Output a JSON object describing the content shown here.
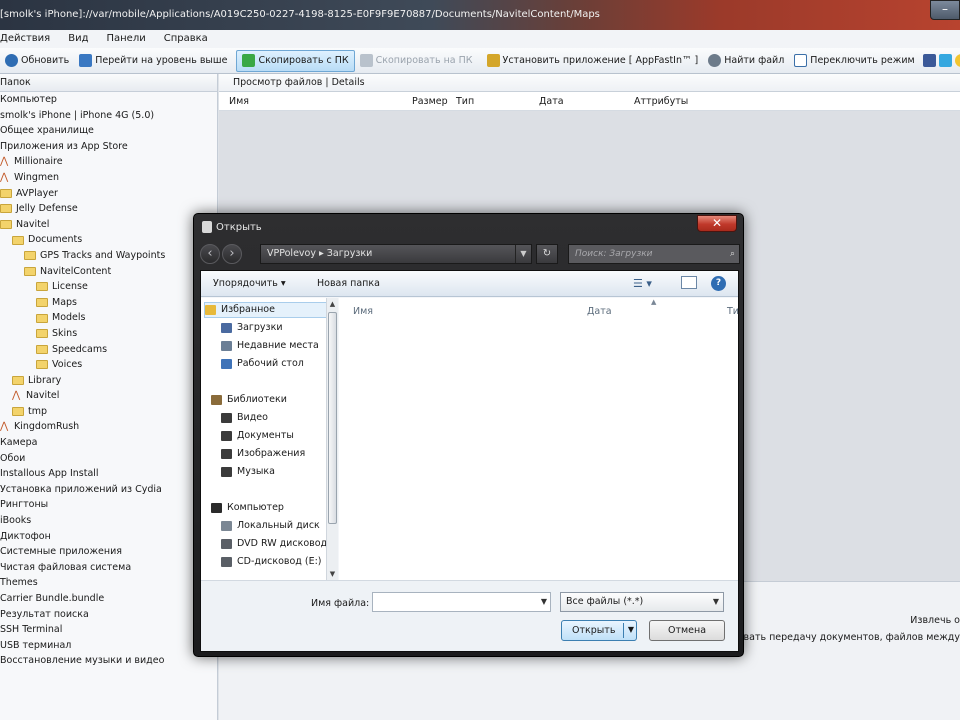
{
  "window": {
    "title": "[smolk's iPhone]://var/mobile/Applications/A019C250-0227-4198-8125-E0F9F9E70887/Documents/NavitelContent/Maps"
  },
  "menu": [
    "Действия",
    "Вид",
    "Панели",
    "Справка"
  ],
  "toolbar": {
    "refresh": "Обновить",
    "up": "Перейти на уровень выше",
    "copy_to_pc": "Скопировать с ПК",
    "copy_from_pc": "Скопировать на ПК",
    "install_app": "Установить приложение [ AppFastIn™ ]",
    "find_file": "Найти файл",
    "switch_mode": "Переключить режим"
  },
  "left_panel": {
    "header": "Папок",
    "tree": [
      {
        "label": "Компьютер",
        "indent": 0,
        "icon": "none"
      },
      {
        "label": "smolk's iPhone | iPhone 4G (5.0)",
        "indent": 0,
        "icon": "none"
      },
      {
        "label": "Общее хранилище",
        "indent": 0,
        "icon": "none"
      },
      {
        "label": "Приложения из App Store",
        "indent": 0,
        "icon": "none"
      },
      {
        "label": "Millionaire",
        "indent": 0,
        "icon": "app"
      },
      {
        "label": "Wingmen",
        "indent": 0,
        "icon": "app"
      },
      {
        "label": "AVPlayer",
        "indent": 0,
        "icon": "folder"
      },
      {
        "label": "Jelly Defense",
        "indent": 0,
        "icon": "folder"
      },
      {
        "label": "Navitel",
        "indent": 0,
        "icon": "folder"
      },
      {
        "label": "Documents",
        "indent": 1,
        "icon": "folder"
      },
      {
        "label": "GPS Tracks and Waypoints",
        "indent": 2,
        "icon": "folder"
      },
      {
        "label": "NavitelContent",
        "indent": 2,
        "icon": "folder"
      },
      {
        "label": "License",
        "indent": 3,
        "icon": "folder"
      },
      {
        "label": "Maps",
        "indent": 3,
        "icon": "folder"
      },
      {
        "label": "Models",
        "indent": 3,
        "icon": "folder"
      },
      {
        "label": "Skins",
        "indent": 3,
        "icon": "folder"
      },
      {
        "label": "Speedcams",
        "indent": 3,
        "icon": "folder"
      },
      {
        "label": "Voices",
        "indent": 3,
        "icon": "folder"
      },
      {
        "label": "Library",
        "indent": 1,
        "icon": "folder"
      },
      {
        "label": "Navitel",
        "indent": 1,
        "icon": "app"
      },
      {
        "label": "tmp",
        "indent": 1,
        "icon": "folder"
      },
      {
        "label": "KingdomRush",
        "indent": 0,
        "icon": "app"
      },
      {
        "label": "Камера",
        "indent": 0,
        "icon": "none"
      },
      {
        "label": "Обои",
        "indent": 0,
        "icon": "none"
      },
      {
        "label": "Installous App Install",
        "indent": 0,
        "icon": "none"
      },
      {
        "label": "Установка приложений из Cydia",
        "indent": 0,
        "icon": "none"
      },
      {
        "label": "Рингтоны",
        "indent": 0,
        "icon": "none"
      },
      {
        "label": "iBooks",
        "indent": 0,
        "icon": "none"
      },
      {
        "label": "Диктофон",
        "indent": 0,
        "icon": "none"
      },
      {
        "label": "Системные приложения",
        "indent": 0,
        "icon": "none"
      },
      {
        "label": "Чистая файловая система",
        "indent": 0,
        "icon": "none"
      },
      {
        "label": "Themes",
        "indent": 0,
        "icon": "none"
      },
      {
        "label": "Carrier Bundle.bundle",
        "indent": 0,
        "icon": "none"
      },
      {
        "label": "Результат поиска",
        "indent": 0,
        "icon": "none"
      },
      {
        "label": "SSH Terminal",
        "indent": 0,
        "icon": "none"
      },
      {
        "label": "USB терминал",
        "indent": 0,
        "icon": "none"
      },
      {
        "label": "Восстановление музыки и видео",
        "indent": 0,
        "icon": "none"
      }
    ]
  },
  "right_panel": {
    "breadcrumb": "Просмотр файлов  |  Details",
    "columns": {
      "name": "Имя",
      "size": "Размер",
      "type": "Тип",
      "date": "Дата",
      "attrs": "Аттрибуты"
    },
    "bottom_text_1": "Извлечь о",
    "bottom_text_2": "льзовать передачу документов, файлов между"
  },
  "dialog": {
    "title": "Открыть",
    "address": "VPPolevoy  ▸  Загрузки",
    "search_placeholder": "Поиск: Загрузки",
    "organize": "Упорядочить ▾",
    "new_folder": "Новая папка",
    "nav": {
      "favorites": "Избранное",
      "downloads": "Загрузки",
      "recent": "Недавние места",
      "desktop": "Рабочий стол",
      "libraries": "Библиотеки",
      "video": "Видео",
      "documents": "Документы",
      "images": "Изображения",
      "music": "Музыка",
      "computer": "Компьютер",
      "local_disk": "Локальный диск",
      "dvd": "DVD RW дисковод",
      "cd": "CD-дисковод (E:)"
    },
    "columns": {
      "name": "Имя",
      "date": "Дата",
      "type": "Ти"
    },
    "filename_label": "Имя файла:",
    "filename_value": "",
    "filetype": "Все файлы (*.*)",
    "open": "Открыть",
    "cancel": "Отмена"
  }
}
